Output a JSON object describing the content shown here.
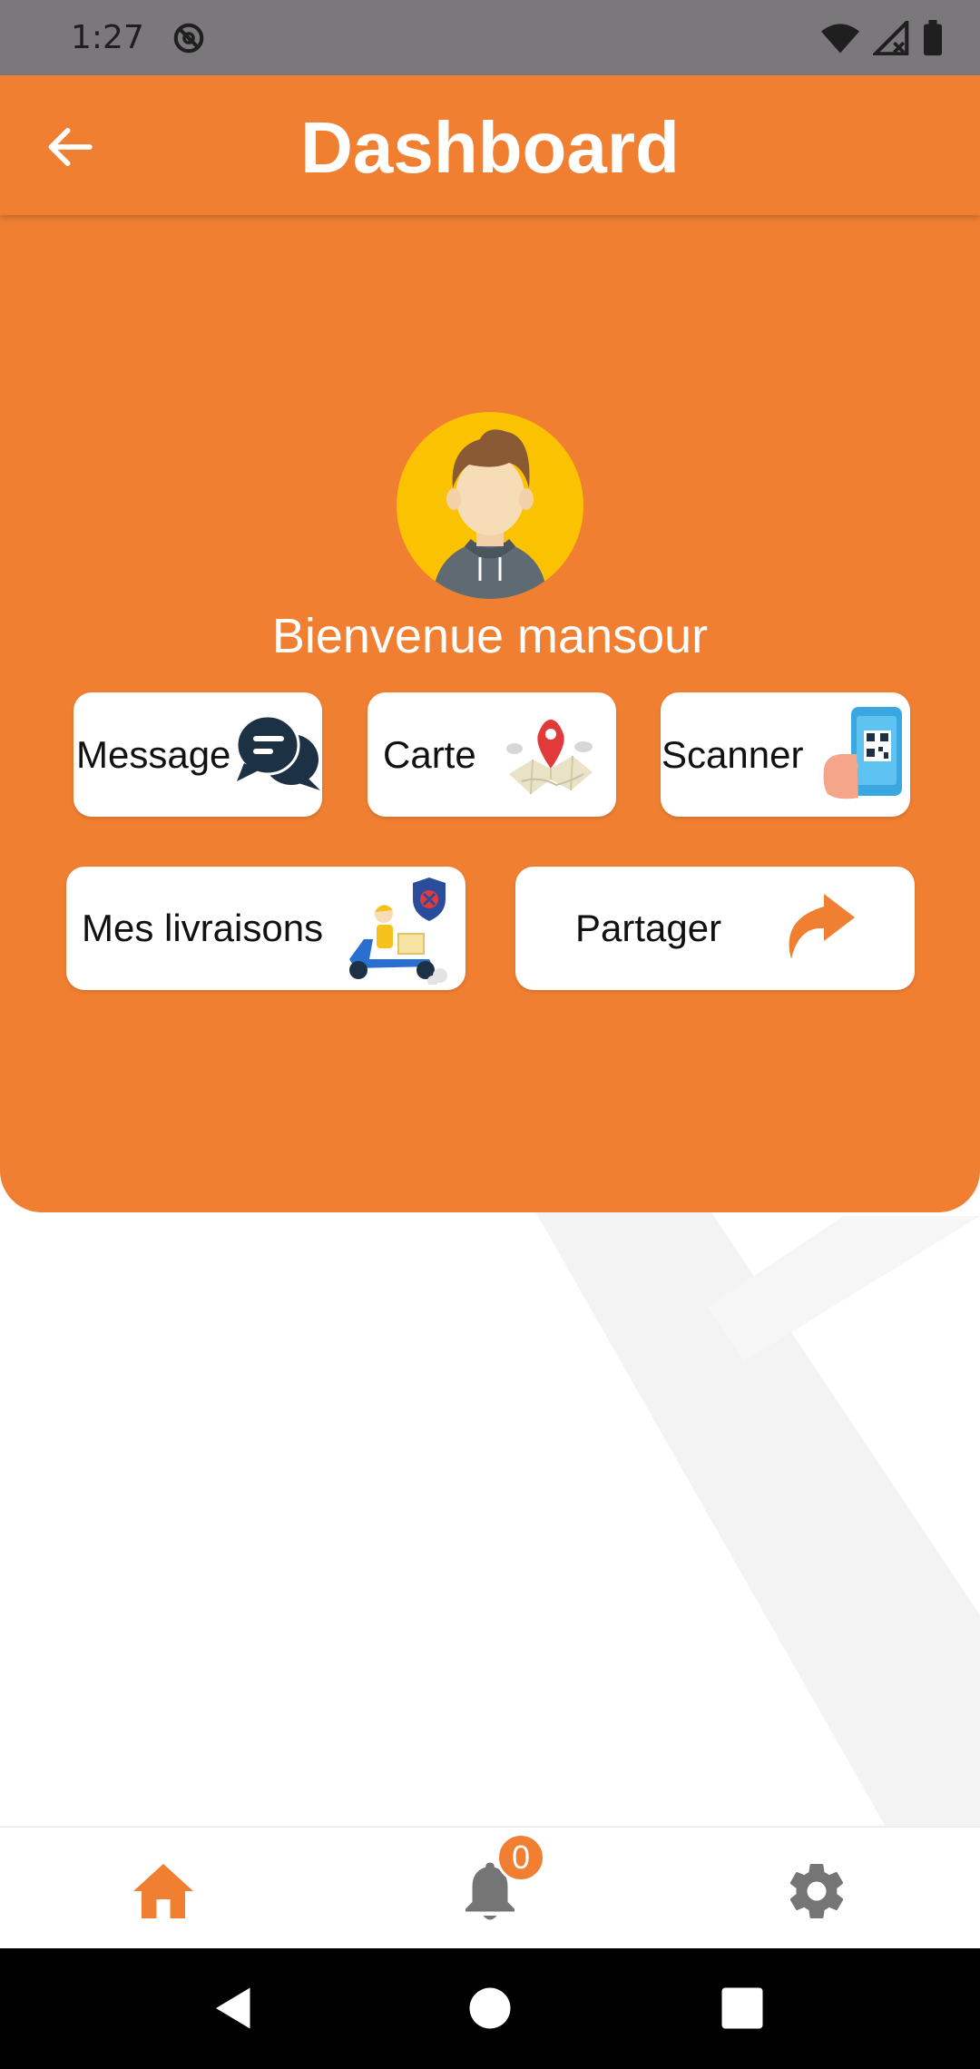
{
  "status_bar": {
    "time": "1:27",
    "icons": [
      "do-not-disturb-icon",
      "wifi-icon",
      "signal-icon",
      "battery-icon"
    ]
  },
  "app_bar": {
    "title": "Dashboard",
    "back_icon": "arrow-back-icon"
  },
  "colors": {
    "primary": "#f07f32",
    "avatar_bg": "#fbc201",
    "card_bg": "#ffffff",
    "nav_active": "#f07f32",
    "nav_inactive": "#757575"
  },
  "profile": {
    "welcome_text": "Bienvenue mansour"
  },
  "actions": [
    {
      "label": "Message",
      "icon": "chat-bubbles-icon"
    },
    {
      "label": "Carte",
      "icon": "map-pin-icon"
    },
    {
      "label": "Scanner",
      "icon": "qr-phone-icon"
    },
    {
      "label": "Mes livraisons",
      "icon": "delivery-scooter-icon"
    },
    {
      "label": "Partager",
      "icon": "share-arrow-icon"
    }
  ],
  "bottom_nav": {
    "items": [
      {
        "name": "home",
        "icon": "home-icon",
        "active": true
      },
      {
        "name": "notifications",
        "icon": "bell-icon",
        "active": false
      },
      {
        "name": "settings",
        "icon": "gear-icon",
        "active": false
      }
    ],
    "notification_count": "0"
  },
  "system_nav": {
    "icons": [
      "back-triangle-icon",
      "home-circle-icon",
      "recents-square-icon"
    ]
  }
}
